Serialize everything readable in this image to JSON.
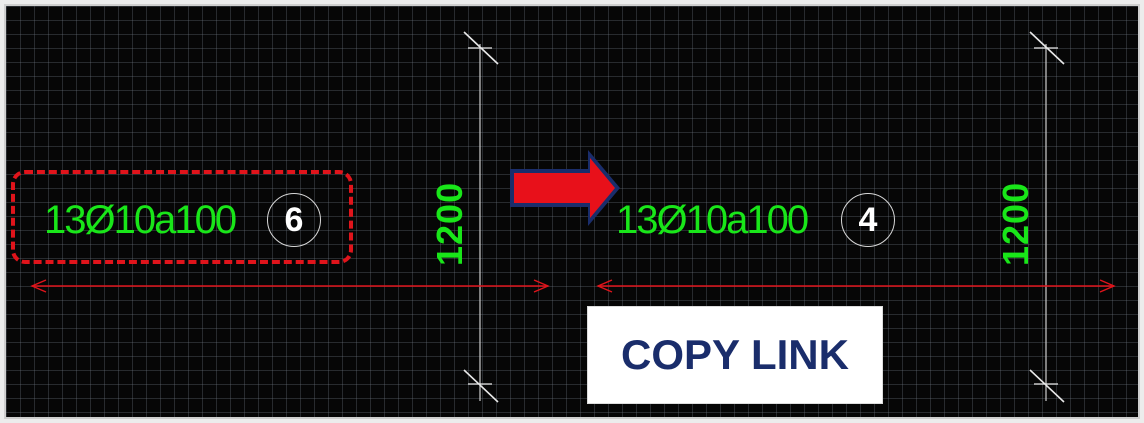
{
  "drawing": {
    "left_panel": {
      "label": "13Ø10a100",
      "mark_number": "6",
      "dimension": "1200"
    },
    "right_panel": {
      "label": "13Ø10a100",
      "mark_number": "4",
      "dimension": "1200"
    }
  },
  "copy_link": {
    "label": "COPY LINK"
  },
  "colors": {
    "background": "#060606",
    "grid": "#6e7882",
    "annotation_text": "#19e619",
    "dimension_line": "#e0141b",
    "arrow": "#e8101a",
    "button_text": "#1a2d6b"
  },
  "icons": [
    "right-arrow-icon",
    "dimension-tick-icon"
  ]
}
